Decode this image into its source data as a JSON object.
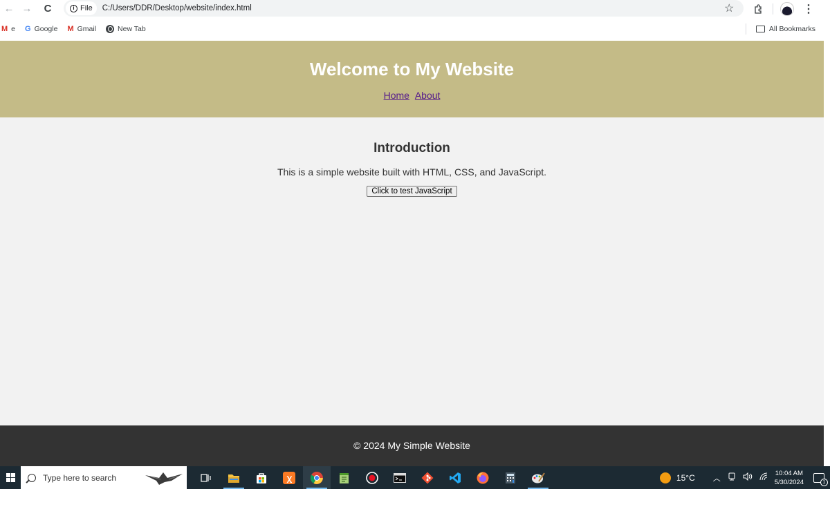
{
  "browser": {
    "back_glyph": "←",
    "forward_glyph": "→",
    "reload_glyph": "C",
    "file_chip_label": "File",
    "url": "C:/Users/DDR/Desktop/website/index.html",
    "star_glyph": "☆",
    "menu_glyph": "⋮"
  },
  "bookmarks": {
    "items": [
      {
        "label": "e",
        "icon": "gmail-m-icon"
      },
      {
        "label": "Google",
        "icon": "google-g-icon"
      },
      {
        "label": "Gmail",
        "icon": "gmail-m-icon"
      },
      {
        "label": "New Tab",
        "icon": "globe-icon"
      }
    ],
    "all_bookmarks_label": "All Bookmarks"
  },
  "site": {
    "title": "Welcome to My Website",
    "nav": [
      "Home",
      "About"
    ],
    "intro_heading": "Introduction",
    "intro_text": "This is a simple website built with HTML, CSS, and JavaScript.",
    "button_label": "Click to test JavaScript",
    "footer_text": "© 2024 My Simple Website",
    "header_color": "#c4bb87",
    "footer_color": "#333333",
    "body_color": "#f2f2f2"
  },
  "taskbar": {
    "search_placeholder": "Type here to search",
    "weather_temp": "15°C",
    "time": "10:04 AM",
    "date": "5/30/2024",
    "notification_count": "1",
    "apps": [
      "task-view-icon",
      "file-explorer-icon",
      "store-icon",
      "xampp-icon",
      "chrome-icon",
      "notepad-icon",
      "recorder-icon",
      "terminal-icon",
      "git-icon",
      "vscode-icon",
      "firefox-icon",
      "calculator-icon",
      "paint-icon"
    ]
  }
}
